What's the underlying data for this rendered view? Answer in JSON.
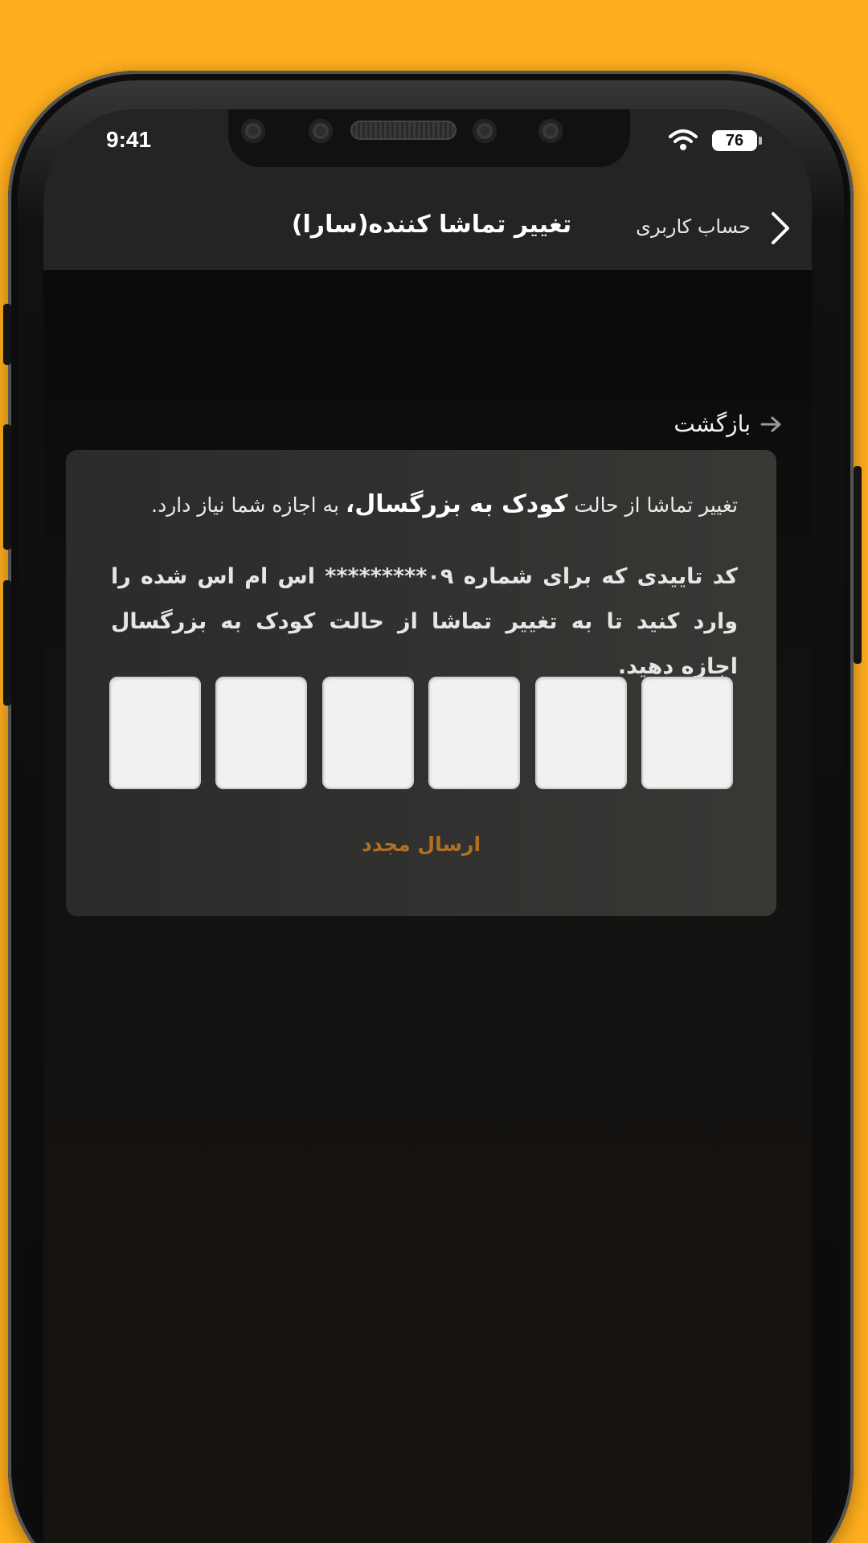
{
  "status_bar": {
    "time": "9:41",
    "battery": "76",
    "wifi_icon": "wifi-icon"
  },
  "header": {
    "title": "تغییر تماشا کننده(سارا)",
    "account_label": "حساب کاربری",
    "back_icon": "chevron-right-icon"
  },
  "back_link": {
    "label": "بازگشت",
    "icon": "arrow-right-icon"
  },
  "card": {
    "intro_prefix": "تغییر تماشا از حالت ",
    "intro_bold": "کودک به بزرگسال،",
    "intro_suffix": " به اجازه شما نیاز دارد.",
    "instruction": "کد تاییدی که برای شماره  ۰۹*********  اس ام اس شده را وارد کنید تا به تغییر تماشا از حالت کودک به بزرگسال اجازه دهید.",
    "otp_digits": [
      "",
      "",
      "",
      "",
      "",
      ""
    ],
    "resend_label": "ارسال مجدد"
  },
  "colors": {
    "background": "#FFAE1D",
    "header": "#242424",
    "card": "#323230",
    "resend": "#B07024"
  }
}
